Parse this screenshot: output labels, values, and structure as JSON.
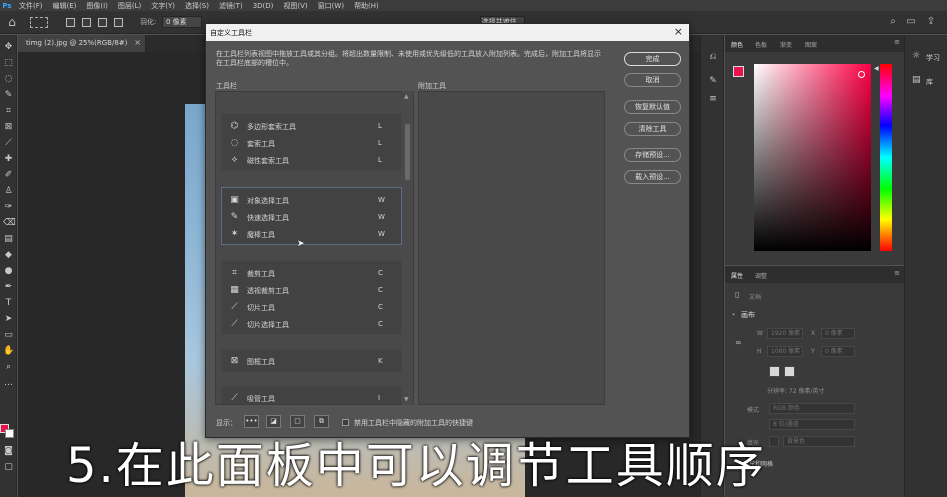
{
  "menubar": {
    "logo": "Ps",
    "items": [
      "文件(F)",
      "编辑(E)",
      "图像(I)",
      "图层(L)",
      "文字(Y)",
      "选择(S)",
      "滤镜(T)",
      "3D(D)",
      "视图(V)",
      "窗口(W)",
      "帮助(H)"
    ]
  },
  "options": {
    "feather_label": "羽化:",
    "feather_value": "0 像素",
    "select_mask_label": "选择并遮住..."
  },
  "document": {
    "tab_label": "timg (2).jpg @ 25%(RGB/8#)",
    "close": "×"
  },
  "dialog": {
    "title": "自定义工具栏",
    "close": "×",
    "description": "在工具栏列表视图中拖放工具或其分组。将超出数量限制、未使用或优先级低的工具放入附加列表。完成后，附加工具将显示在工具栏底部的槽位中。",
    "toolbar_header": "工具栏",
    "extra_header": "附加工具",
    "groups": [
      {
        "tools": [
          {
            "name": "多边形套索工具",
            "key": "L",
            "icon": "polygon-lasso-icon",
            "glyph": "⌬"
          },
          {
            "name": "套索工具",
            "key": "L",
            "icon": "lasso-icon",
            "glyph": "◌"
          },
          {
            "name": "磁性套索工具",
            "key": "L",
            "icon": "magnetic-lasso-icon",
            "glyph": "⟡"
          }
        ]
      },
      {
        "tools": [
          {
            "name": "对象选择工具",
            "key": "W",
            "icon": "object-select-icon",
            "glyph": "▣"
          },
          {
            "name": "快速选择工具",
            "key": "W",
            "icon": "quick-select-icon",
            "glyph": "✎"
          },
          {
            "name": "魔棒工具",
            "key": "W",
            "icon": "magic-wand-icon",
            "glyph": "✶"
          }
        ]
      },
      {
        "tools": [
          {
            "name": "裁剪工具",
            "key": "C",
            "icon": "crop-icon",
            "glyph": "⌗"
          },
          {
            "name": "透视裁剪工具",
            "key": "C",
            "icon": "perspective-crop-icon",
            "glyph": "▦"
          },
          {
            "name": "切片工具",
            "key": "C",
            "icon": "slice-icon",
            "glyph": "⟋"
          },
          {
            "name": "切片选择工具",
            "key": "C",
            "icon": "slice-select-icon",
            "glyph": "⟋"
          }
        ]
      },
      {
        "tools": [
          {
            "name": "图框工具",
            "key": "K",
            "icon": "frame-icon",
            "glyph": "⊠"
          }
        ]
      },
      {
        "tools": [
          {
            "name": "吸管工具",
            "key": "I",
            "icon": "eyedropper-icon",
            "glyph": "⟋"
          }
        ]
      }
    ],
    "buttons": {
      "done": "完成",
      "cancel": "取消",
      "restore_defaults": "恢复默认值",
      "clear_tools": "清除工具",
      "save_preset": "存储预设...",
      "load_preset": "载入预设..."
    },
    "display_label": "显示：",
    "display_buttons": [
      "•••",
      "◪",
      "▢",
      "⧉"
    ],
    "checkbox_label": "禁用工具栏中隐藏的附加工具的快捷键"
  },
  "color_panel": {
    "tabs": [
      "颜色",
      "色板",
      "渐变",
      "图案"
    ],
    "foreground": "#e8144b",
    "background": "#ffffff"
  },
  "properties_panel": {
    "tabs": [
      "属性",
      "调整"
    ],
    "doc_label": "文档",
    "section": "画布",
    "w_label": "W",
    "h_label": "H",
    "w_value": "1920 像素",
    "h_value": "1080 像素",
    "x_label": "X",
    "y_label": "Y",
    "x_value": "0 像素",
    "y_value": "0 像素",
    "resolution": "分辨率: 72 像素/英寸",
    "mode_label": "模式",
    "mode_value": "RGB 颜色",
    "depth_value": "8 位/通道",
    "fill_label": "填充",
    "fill_value": "背景色",
    "grid_label": "标尺和网格"
  },
  "far_panel": {
    "learn": "学习",
    "library": "库"
  },
  "subtitle": "5.在此面板中可以调节工具顺序"
}
